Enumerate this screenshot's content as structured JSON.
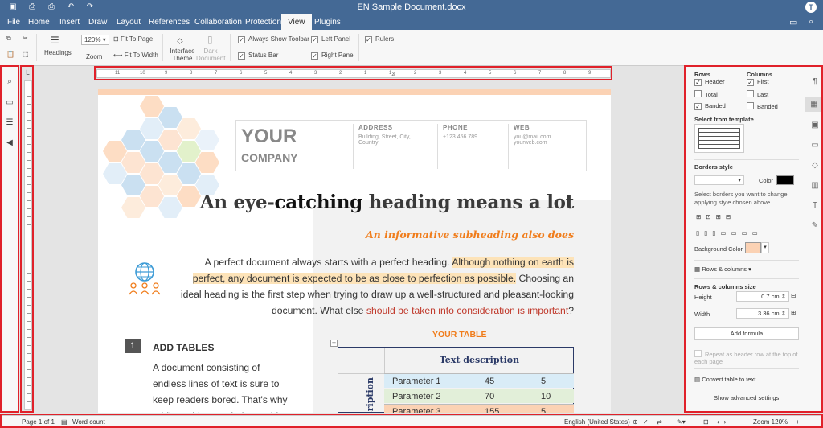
{
  "app": {
    "doc_title": "EN Sample Document.docx",
    "user_initial": "T"
  },
  "menu": {
    "tabs": [
      "File",
      "Home",
      "Insert",
      "Draw",
      "Layout",
      "References",
      "Collaboration",
      "Protection",
      "View",
      "Plugins"
    ],
    "active": "View"
  },
  "toolbar": {
    "headings": "Headings",
    "zoom_value": "120%",
    "zoom": "Zoom",
    "fit_to_page": "Fit To Page",
    "fit_to_width": "Fit To Width",
    "interface_theme": "Interface Theme",
    "dark_document": "Dark Document",
    "always_show_toolbar": "Always Show Toolbar",
    "status_bar": "Status Bar",
    "left_panel": "Left Panel",
    "right_panel": "Right Panel",
    "rulers": "Rulers"
  },
  "ruler": {
    "labels": [
      "11",
      "10",
      "9",
      "8",
      "7",
      "6",
      "5",
      "4",
      "3",
      "2",
      "1",
      "1",
      "2",
      "3",
      "4",
      "5",
      "6",
      "7",
      "8",
      "9"
    ]
  },
  "document": {
    "company_your": "YOUR",
    "company_name": "COMPANY",
    "address_label": "ADDRESS",
    "address_value": "Building, Street, City, Country",
    "phone_label": "PHONE",
    "phone_value": "+123 456 789",
    "web_label": "WEB",
    "web_value1": "you@mail.com",
    "web_value2": "yourweb.com",
    "heading_a": "An eye-",
    "heading_b": "catching",
    "heading_c": " heading means a lot",
    "subheading": "An informative subheading also does",
    "para_1": "A perfect document always starts with a perfect heading. ",
    "para_hl": "Although nothing on earth is perfect, any document is expected to be as close to perfection as possible.",
    "para_2": " Choosing an ideal heading is the first step when trying to draw up a well-structured and pleasant-looking document. What else ",
    "para_strike": "should be taken into consideration",
    "para_ins": " is important",
    "para_end": "?",
    "section_num": "1",
    "section_title": "ADD TABLES",
    "section_body": "A document consisting of endless lines of text is sure to keep readers bored. That's why adding tables can help provide",
    "table_title": "YOUR TABLE",
    "table_header": "Text description",
    "table_side": "Text description",
    "table_rows": [
      [
        "Parameter 1",
        "45",
        "5"
      ],
      [
        "Parameter 2",
        "70",
        "10"
      ],
      [
        "Parameter 3",
        "155",
        "5"
      ]
    ]
  },
  "right_panel": {
    "rows": "Rows",
    "columns": "Columns",
    "header": "Header",
    "total": "Total",
    "banded_r": "Banded",
    "first": "First",
    "last": "Last",
    "banded_c": "Banded",
    "select_template": "Select from template",
    "borders_style": "Borders style",
    "color": "Color",
    "borders_hint": "Select borders you want to change applying style chosen above",
    "background_color": "Background Color",
    "rows_columns": "Rows & columns",
    "size_title": "Rows & columns size",
    "height": "Height",
    "height_val": "0.7 cm",
    "width": "Width",
    "width_val": "3.36 cm",
    "add_formula": "Add formula",
    "repeat_header": "Repeat as header row at the top of each page",
    "convert": "Convert table to text",
    "advanced": "Show advanced settings"
  },
  "status": {
    "page": "Page 1 of 1",
    "word_count": "Word count",
    "language": "English (United States)",
    "zoom": "Zoom 120%"
  },
  "colors": {
    "brand": "#446995",
    "accent_orange": "#f07d1c",
    "table_navy": "#2b3a67",
    "highlight": "#fde3b8",
    "bg_color_swatch": "#fbd2b4"
  }
}
